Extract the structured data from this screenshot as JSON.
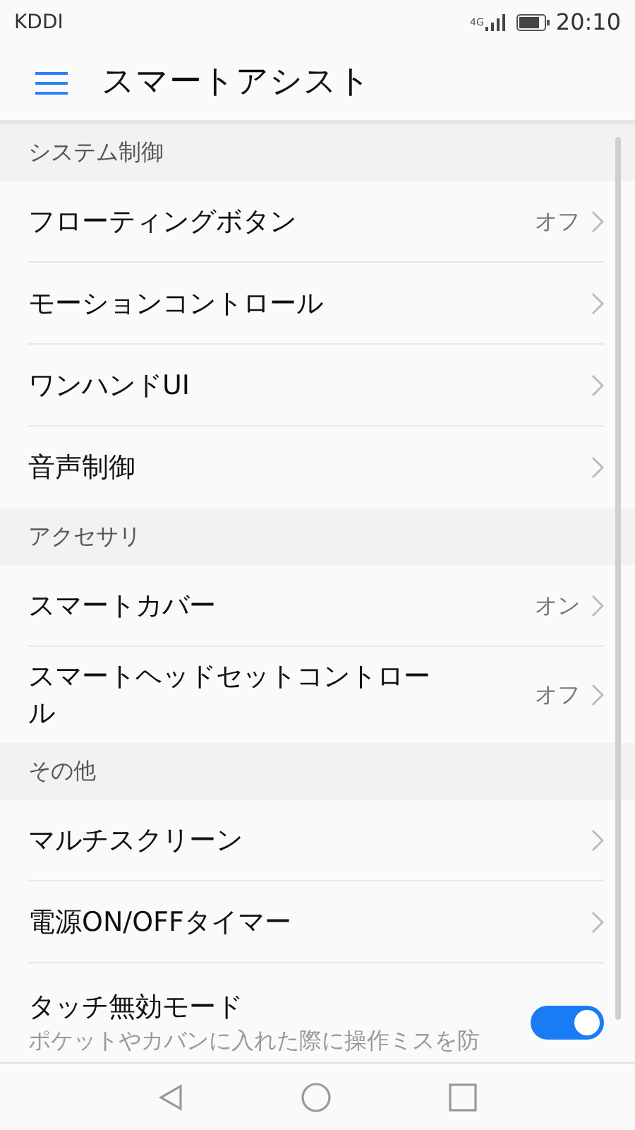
{
  "status_bar": {
    "carrier": "KDDI",
    "network": "4G",
    "time": "20:10"
  },
  "app_bar": {
    "title": "スマートアシスト"
  },
  "sections": [
    {
      "header": "システム制御",
      "items": [
        {
          "kind": "link",
          "title": "フローティングボタン",
          "value": "オフ"
        },
        {
          "kind": "link",
          "title": "モーションコントロール"
        },
        {
          "kind": "link",
          "title": "ワンハンドUI"
        },
        {
          "kind": "link",
          "title": "音声制御"
        }
      ]
    },
    {
      "header": "アクセサリ",
      "items": [
        {
          "kind": "link",
          "title": "スマートカバー",
          "value": "オン"
        },
        {
          "kind": "link",
          "title": "スマートヘッドセットコントロール",
          "value": "オフ"
        }
      ]
    },
    {
      "header": "その他",
      "items": [
        {
          "kind": "link",
          "title": "マルチスクリーン"
        },
        {
          "kind": "link",
          "title": "電源ON/OFFタイマー"
        },
        {
          "kind": "toggle",
          "title": "タッチ無効モード",
          "description": "ポケットやカバンに入れた際に操作ミスを防",
          "on": true
        }
      ]
    }
  ]
}
